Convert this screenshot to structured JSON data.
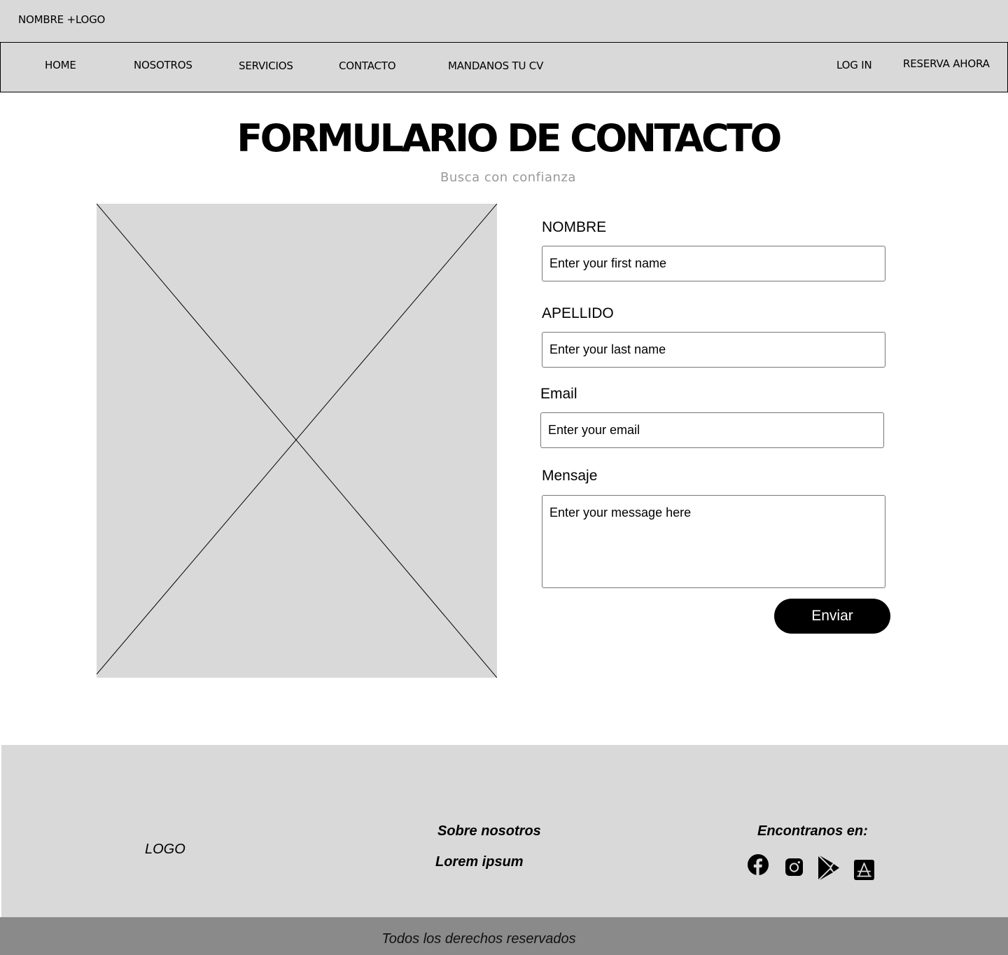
{
  "header": {
    "brand": "NOMBRE +LOGO"
  },
  "nav": {
    "home": "HOME",
    "nosotros": "NOSOTROS",
    "servicios": "SERVICIOS",
    "contacto": "CONTACTO",
    "cv": "MANDANOS TU CV",
    "login": "LOG IN",
    "reserva": "RESERVA AHORA"
  },
  "main": {
    "title": "FORMULARIO DE CONTACTO",
    "subtitle": "Busca con confianza"
  },
  "form": {
    "nombre": {
      "label": "NOMBRE",
      "placeholder": "Enter your first name",
      "value": ""
    },
    "apellido": {
      "label": "APELLIDO",
      "placeholder": "Enter your last name",
      "value": ""
    },
    "email": {
      "label": "Email",
      "placeholder": "Enter your email",
      "value": ""
    },
    "mensaje": {
      "label": "Mensaje",
      "placeholder": "Enter your message here",
      "value": ""
    },
    "submit_label": "Enviar"
  },
  "footer": {
    "logo": "LOGO",
    "about_title": "Sobre nosotros",
    "about_text": "Lorem ipsum",
    "social_title": "Encontranos en:",
    "social_icons": [
      "facebook-icon",
      "instagram-icon",
      "google-play-icon",
      "app-store-icon"
    ],
    "copyright": "Todos los derechos reservados"
  },
  "colors": {
    "header_bg": "#d9d9d9",
    "bottom_bar_bg": "#8a8a8a",
    "accent": "#000000",
    "subtitle": "#999999"
  }
}
